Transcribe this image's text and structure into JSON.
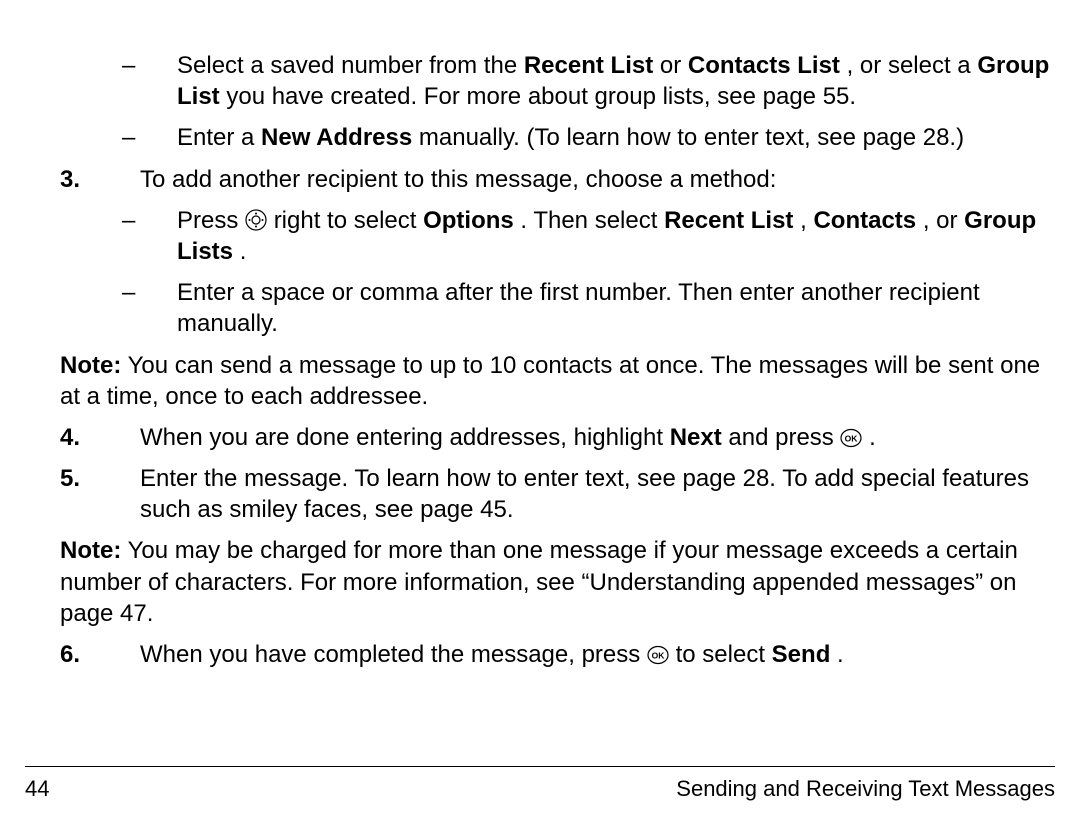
{
  "dashes": {
    "a": "–",
    "b": "–",
    "c": "–",
    "d": "–"
  },
  "sub_a": {
    "t1": "Select a saved number from the",
    "b1": "Recent List",
    "t2": " or ",
    "b2": "Contacts List",
    "t3": ", or select a ",
    "b3": "Group List",
    "t4": " you have created. For more about group lists, see page 55."
  },
  "sub_b": {
    "t1": "Enter a ",
    "b1": "New Address",
    "t2": " manually. (To learn how to enter text, see page 28.)"
  },
  "step3": {
    "num": "3.",
    "text": "To add another recipient to this message, choose a method:"
  },
  "sub_c": {
    "t1": "Press ",
    "t2": " right to select ",
    "b1": "Options",
    "t3": ". Then select ",
    "b2": "Recent List",
    "t4": ", ",
    "b3": "Contacts",
    "t5": ", or ",
    "b4": "Group Lists",
    "t6": "."
  },
  "sub_d": {
    "t1": "Enter a space or comma after the first number. Then enter another recipient manually."
  },
  "note1": {
    "label": "Note:",
    "text": " You can send a message to up to 10 contacts at once. The messages will be sent one at a time, once to each addressee."
  },
  "step4": {
    "num": "4.",
    "t1": "When you are done entering addresses, highlight ",
    "b1": "Next",
    "t2": " and press ",
    "t3": "."
  },
  "step5": {
    "num": "5.",
    "text": "Enter the message. To learn how to enter text, see page 28. To add special features such as smiley faces, see page 45."
  },
  "note2": {
    "label": "Note:",
    "text": " You may be charged for more than one message if your message exceeds a certain number of characters. For more information, see “Understanding appended messages” on page 47."
  },
  "step6": {
    "num": "6.",
    "t1": "When you have completed the message, press ",
    "t2": " to select ",
    "b1": "Send",
    "t3": "."
  },
  "footer": {
    "page": "44",
    "title": "Sending and Receiving Text Messages"
  }
}
